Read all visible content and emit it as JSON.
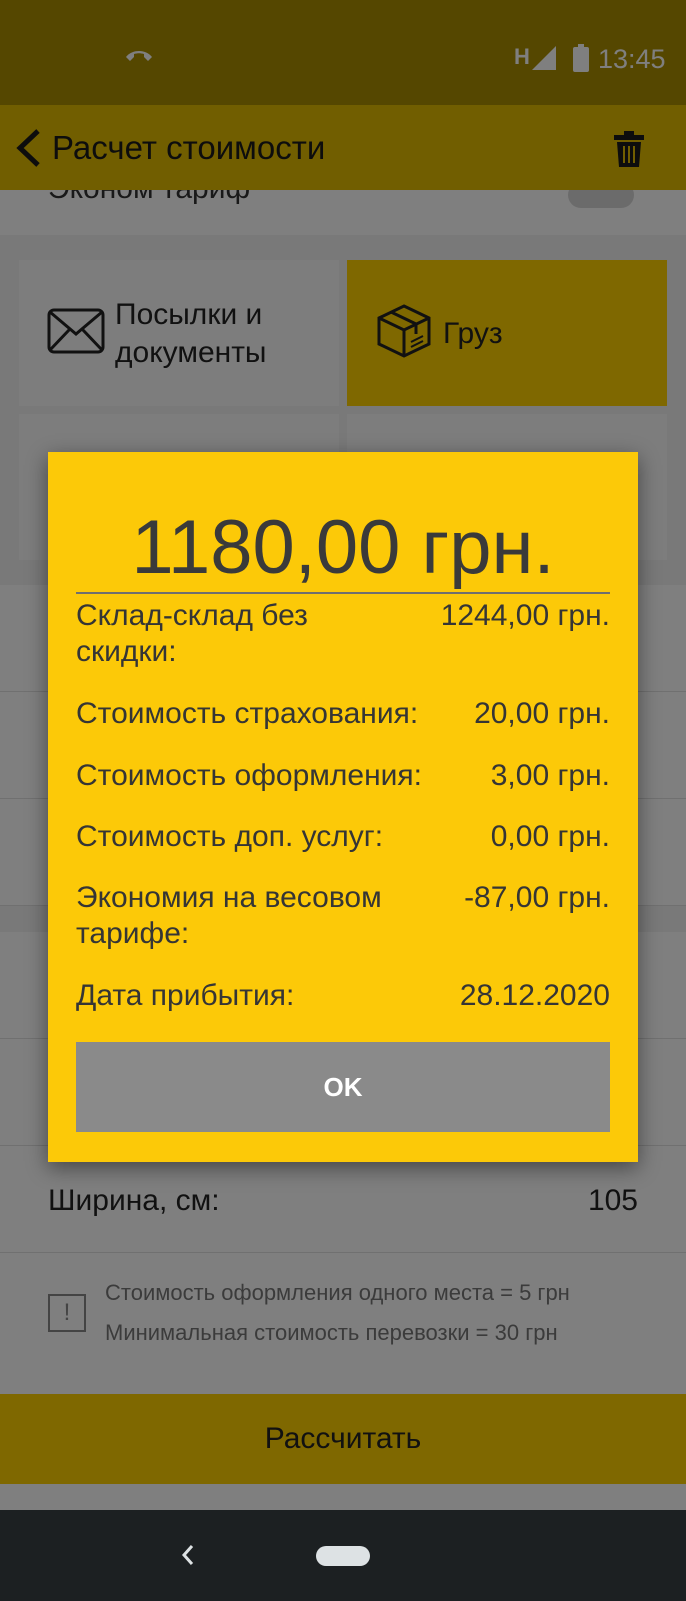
{
  "status_bar": {
    "network": "H",
    "time": "13:45"
  },
  "app_bar": {
    "title": "Расчет стоимости"
  },
  "settings": {
    "econom_label": "Эконом тариф"
  },
  "tiles": [
    {
      "label_line1": "Посылки и",
      "label_line2": "документы",
      "icon": "envelope-icon",
      "selected": false
    },
    {
      "label": "Груз",
      "icon": "box-icon",
      "selected": true
    }
  ],
  "form": {
    "width_label": "Ширина, см:",
    "width_value": "105"
  },
  "info": {
    "line1": "Стоимость оформления одного места = 5 грн",
    "line2": "Минимальная стоимость перевозки = 30 грн"
  },
  "calculate_label": "Рассчитать",
  "dialog": {
    "total": "1180,00 грн.",
    "rows": [
      {
        "label_line1": "Склад-склад без",
        "label_line2": "скидки:",
        "value": "1244,00 грн."
      },
      {
        "label": "Стоимость страхования:",
        "value": "20,00 грн."
      },
      {
        "label": "Стоимость оформления:",
        "value": "3,00 грн."
      },
      {
        "label": "Стоимость доп. услуг:",
        "value": "0,00 грн."
      },
      {
        "label_line1": "Экономия на весовом",
        "label_line2": "тарифе:",
        "value": "-87,00 грн."
      },
      {
        "label": "Дата прибытия:",
        "value": "28.12.2020"
      }
    ],
    "ok_label": "OK"
  },
  "colors": {
    "brand_yellow": "#ffd000",
    "dialog_yellow": "#fcc908",
    "ok_button_gray": "#8a8a8a",
    "status_bar": "#ab8f00"
  }
}
